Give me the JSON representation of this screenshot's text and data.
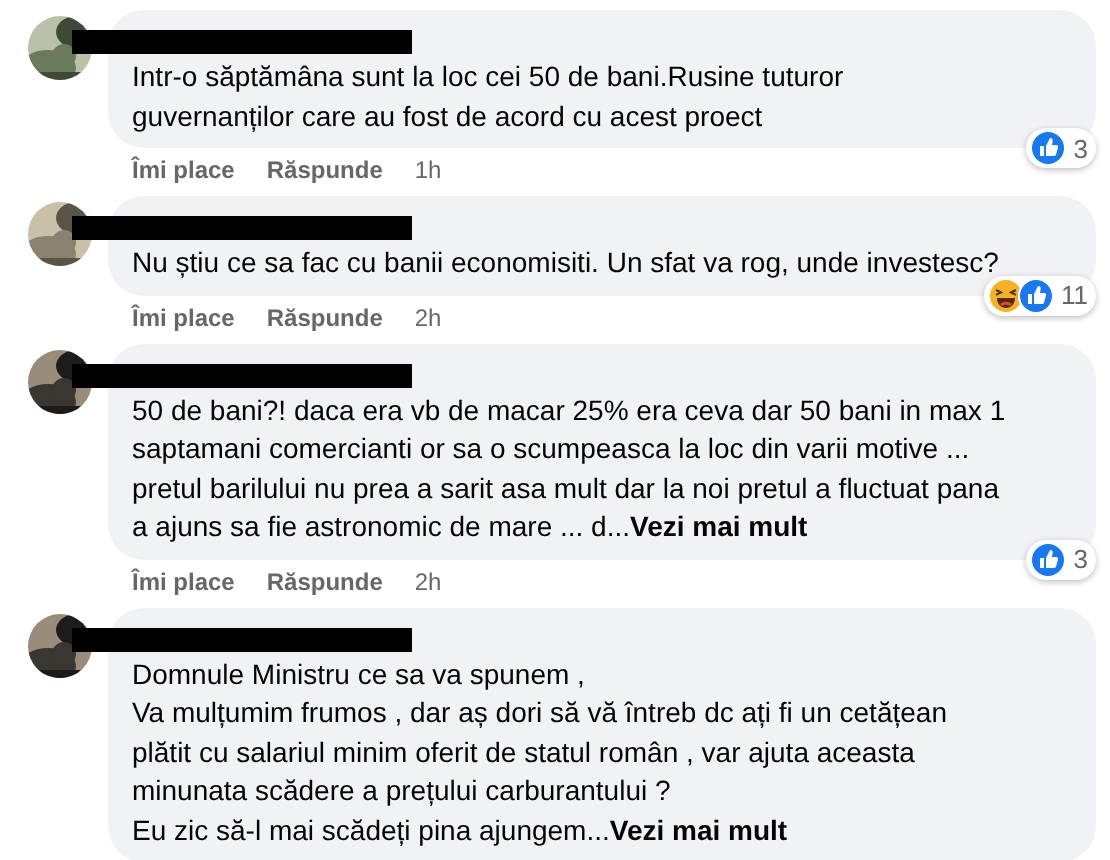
{
  "comments": [
    {
      "name_redacted": true,
      "text": "Intr-o săptămâna sunt la loc cei 50 de bani.Rusine tuturor\nguvernanților care au fost de acord cu acest proect",
      "actions": [
        "Îmi place",
        "Răspunde"
      ],
      "time": "1h",
      "reactions": [
        {
          "kind": "like"
        }
      ],
      "reaction_count": "3"
    },
    {
      "name_redacted": true,
      "text": "Nu știu ce sa fac cu banii economisiti. Un sfat va rog, unde investesc?",
      "actions": [
        "Îmi place",
        "Răspunde"
      ],
      "time": "2h",
      "reactions": [
        {
          "kind": "haha"
        },
        {
          "kind": "like"
        }
      ],
      "reaction_count": "11"
    },
    {
      "name_redacted": true,
      "text": "50 de bani?! daca era vb de macar 25% era ceva dar 50 bani in max 1\nsaptamani comercianti or sa o scumpeasca la loc din varii motive ...\npretul barilului nu prea a sarit asa mult dar la noi pretul a fluctuat pana\na ajuns sa fie astronomic de mare ... d...",
      "see_more": "Vezi mai mult",
      "actions": [
        "Îmi place",
        "Răspunde"
      ],
      "time": "2h",
      "reactions": [
        {
          "kind": "like"
        }
      ],
      "reaction_count": "3"
    },
    {
      "name_redacted": true,
      "text": "Domnule Ministru ce sa va spunem ,\nVa mulțumim frumos , dar aș dori să vă întreb dc ați fi un cetățean\nplătit cu salariul minim oferit de statul român , var ajuta aceasta\nminunata scădere a prețului carburantului ?\nEu zic să-l mai scădeți pina ajungem...",
      "see_more": "Vezi mai mult"
    }
  ]
}
